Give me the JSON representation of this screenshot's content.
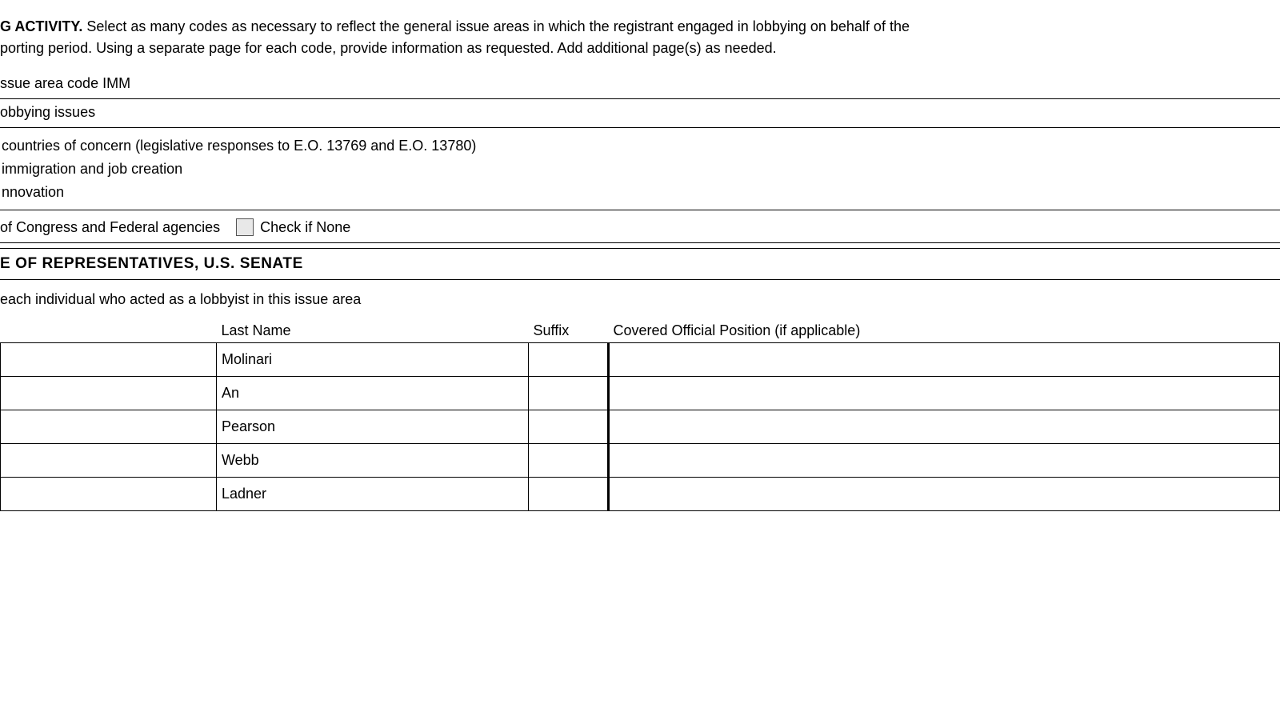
{
  "intro": {
    "bold_text": "G ACTIVITY.",
    "rest_text": " Select as many codes as necessary to reflect the general issue areas in which the registrant engaged in lobbying on behalf of the",
    "line2": "porting period. Using a separate page for each code, provide information as requested. Add additional page(s) as needed."
  },
  "issue_area_code": {
    "label": "ssue area code IMM"
  },
  "lobbying_issues": {
    "label": "obbying issues",
    "items": [
      "countries of concern (legislative responses to E.O. 13769 and E.O. 13780)",
      "immigration and job creation",
      "nnovation"
    ]
  },
  "agencies": {
    "label": "of Congress and Federal agencies",
    "check_none_label": "Check if None"
  },
  "representatives": {
    "text": "E OF REPRESENTATIVES, U.S. SENATE"
  },
  "lobbyist_intro": {
    "text": "each individual who acted as a lobbyist in this issue area"
  },
  "table": {
    "headers": {
      "first_name": "",
      "last_name": "Last Name",
      "suffix": "Suffix",
      "covered": "Covered Official Position (if applicable)"
    },
    "rows": [
      {
        "first_name": "",
        "last_name": "Molinari",
        "suffix": "",
        "covered": ""
      },
      {
        "first_name": "",
        "last_name": "An",
        "suffix": "",
        "covered": ""
      },
      {
        "first_name": "",
        "last_name": "Pearson",
        "suffix": "",
        "covered": ""
      },
      {
        "first_name": "",
        "last_name": "Webb",
        "suffix": "",
        "covered": ""
      },
      {
        "first_name": "",
        "last_name": "Ladner",
        "suffix": "",
        "covered": ""
      }
    ]
  }
}
